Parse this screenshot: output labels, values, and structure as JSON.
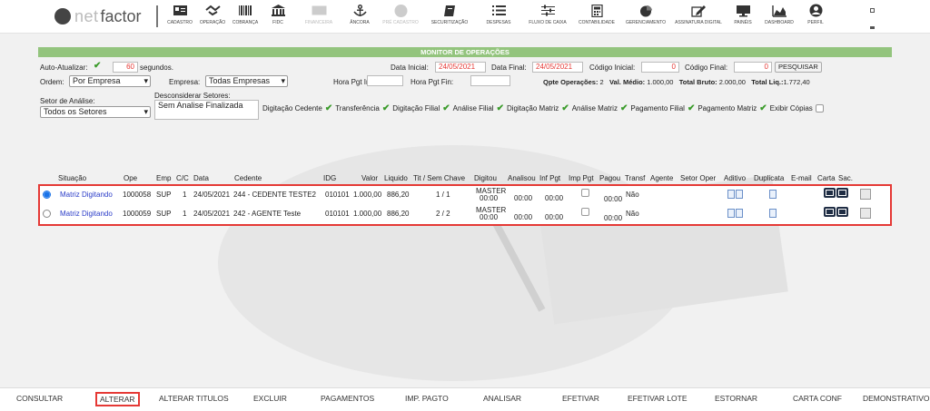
{
  "logo": {
    "prefix": "O",
    "net": "net",
    "factor": "factor"
  },
  "nav": [
    {
      "label": "Cadastro",
      "icon": "id-card-icon"
    },
    {
      "label": "Operação",
      "icon": "handshake-icon"
    },
    {
      "label": "Cobrança",
      "icon": "barcode-icon"
    },
    {
      "label": "FIDC",
      "icon": "bank-icon"
    },
    {
      "label": "Financeira",
      "icon": "money-icon"
    },
    {
      "label": "Âncora",
      "icon": "anchor-icon"
    },
    {
      "label": "Pré Cadastro",
      "icon": "info-icon"
    },
    {
      "label": "Securitização",
      "icon": "book-icon"
    },
    {
      "label": "Despesas",
      "icon": "list-icon"
    },
    {
      "label": "Fluxo de Caixa",
      "icon": "sliders-icon"
    },
    {
      "label": "Contabilidade",
      "icon": "calculator-icon"
    },
    {
      "label": "Gerenciamento",
      "icon": "pie-chart-icon"
    },
    {
      "label": "Assinatura Digital",
      "icon": "pen-square-icon"
    },
    {
      "label": "Painéis",
      "icon": "monitor-icon"
    },
    {
      "label": "Dashboard",
      "icon": "area-chart-icon"
    },
    {
      "label": "Perfil",
      "icon": "user-circle-icon"
    }
  ],
  "monitor": {
    "title": "MONITOR DE OPERAÇÕES",
    "auto_label": "Auto-Atualizar:",
    "auto_value": "60",
    "auto_unit": "segundos.",
    "data_inicial_label": "Data Inicial:",
    "data_inicial": "24/05/2021",
    "data_final_label": "Data Final:",
    "data_final": "24/05/2021",
    "codigo_inicial_label": "Código Inicial:",
    "codigo_inicial": "0",
    "codigo_final_label": "Código Final:",
    "codigo_final": "0",
    "pesquisar": "PESQUISAR",
    "ordem_label": "Ordem:",
    "ordem": "Por Empresa",
    "empresa_label": "Empresa:",
    "empresa": "Todas Empresas",
    "hora_ini_label": "Hora Pgt Ini:",
    "hora_fin_label": "Hora Pgt Fin:",
    "qtde_label": "Qpte Operações:",
    "qtde": "2",
    "val_medio_label": "Val. Médio:",
    "val_medio": "1.000,00",
    "total_bruto_label": "Total Bruto:",
    "total_bruto": "2.000,00",
    "total_liq_label": "Total Liq.:",
    "total_liq": "1.772,40",
    "setor_label": "Setor de Análise:",
    "setor": "Todos os Setores",
    "desconsiderar_label": "Desconsiderar Setores:",
    "desconsiderar_value": "Sem Analise Finalizada",
    "filters": [
      "Digitação Cedente",
      "Transferência",
      "Digitação Filial",
      "Análise Filial",
      "Digitação Matriz",
      "Análise Matriz",
      "Pagamento Filial",
      "Pagamento Matriz",
      "Exibir Cópias"
    ]
  },
  "table": {
    "headers": [
      "Situação",
      "Ope",
      "Emp",
      "C/C",
      "Data",
      "Cedente",
      "IDG",
      "Valor",
      "Liquido",
      "Tit / Sem Chave",
      "Digitou",
      "Analisou",
      "Inf Pgt",
      "Imp Pgt",
      "Pagou",
      "Transf",
      "Agente",
      "Setor Oper",
      "Aditivo",
      "Duplicata",
      "E-mail",
      "Carta",
      "Sac."
    ],
    "rows": [
      {
        "situacao": "Matriz Digitando",
        "ope": "1000058",
        "emp": "SUP",
        "cc": "1",
        "data": "24/05/2021",
        "cedente": "244 - CEDENTE TESTE2",
        "idg": "010101",
        "valor": "1.000,00",
        "liquido": "886,20",
        "tit": "1 / 1",
        "digitou_user": "MASTER",
        "digitou_time": "00:00",
        "analisou": "00:00",
        "inf_pgt": "00:00",
        "pagou": "00:00",
        "transf": "Não"
      },
      {
        "situacao": "Matriz Digitando",
        "ope": "1000059",
        "emp": "SUP",
        "cc": "1",
        "data": "24/05/2021",
        "cedente": "242 - AGENTE Teste",
        "idg": "010101",
        "valor": "1.000,00",
        "liquido": "886,20",
        "tit": "2 / 2",
        "digitou_user": "MASTER",
        "digitou_time": "00:00",
        "analisou": "00:00",
        "inf_pgt": "00:00",
        "pagou": "00:00",
        "transf": "Não"
      }
    ]
  },
  "bottom": [
    "CONSULTAR",
    "ALTERAR",
    "ALTERAR TITULOS",
    "EXCLUIR",
    "PAGAMENTOS",
    "IMP. PAGTO",
    "ANALISAR",
    "EFETIVAR",
    "EFETIVAR LOTE",
    "ESTORNAR",
    "CARTA CONF",
    "DEMONSTRATIVO"
  ],
  "colors": {
    "accent_green": "#93c47d",
    "highlight_red": "#e53935",
    "link_blue": "#2a3cc8"
  }
}
